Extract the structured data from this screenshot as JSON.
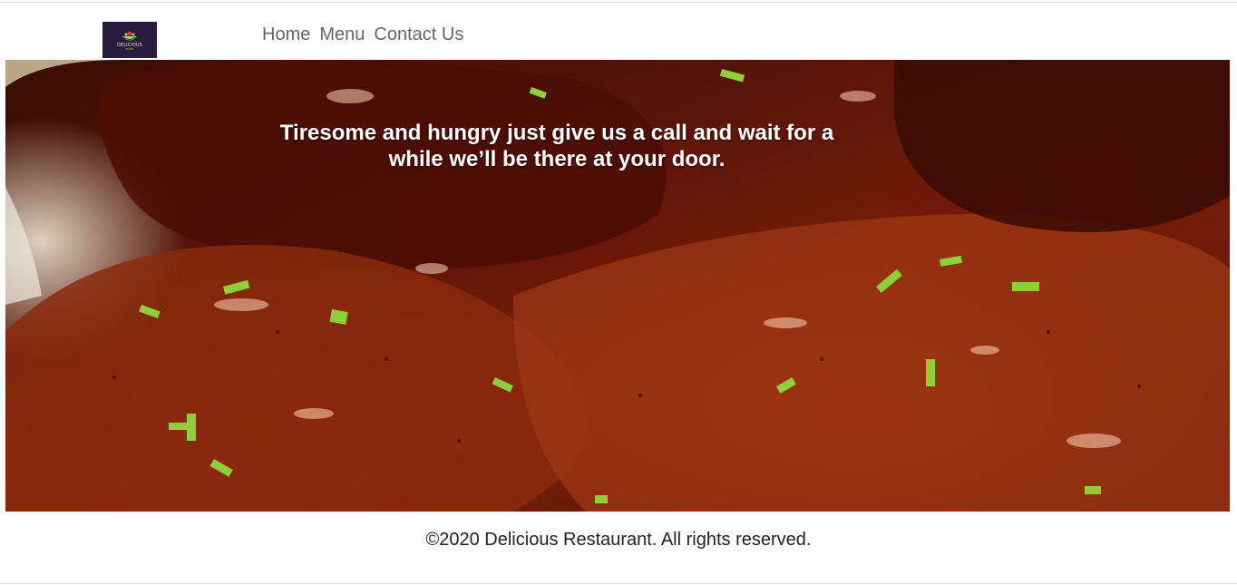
{
  "header": {
    "logo": {
      "name": "DELICIOUS",
      "tagline": "FOOD"
    },
    "nav": {
      "home": "Home",
      "menu": "Menu",
      "contact": "Contact Us"
    }
  },
  "hero": {
    "image_description": "glazed barbecue chicken",
    "headline": "Tiresome and hungry just give us a call and wait for a while we’ll be there at your door."
  },
  "footer": {
    "copyright": "©2020 Delicious Restaurant. All rights reserved."
  },
  "colors": {
    "logo_bg": "#2a1c3f",
    "nav_text": "#666666",
    "hero_text": "#ffffff"
  }
}
